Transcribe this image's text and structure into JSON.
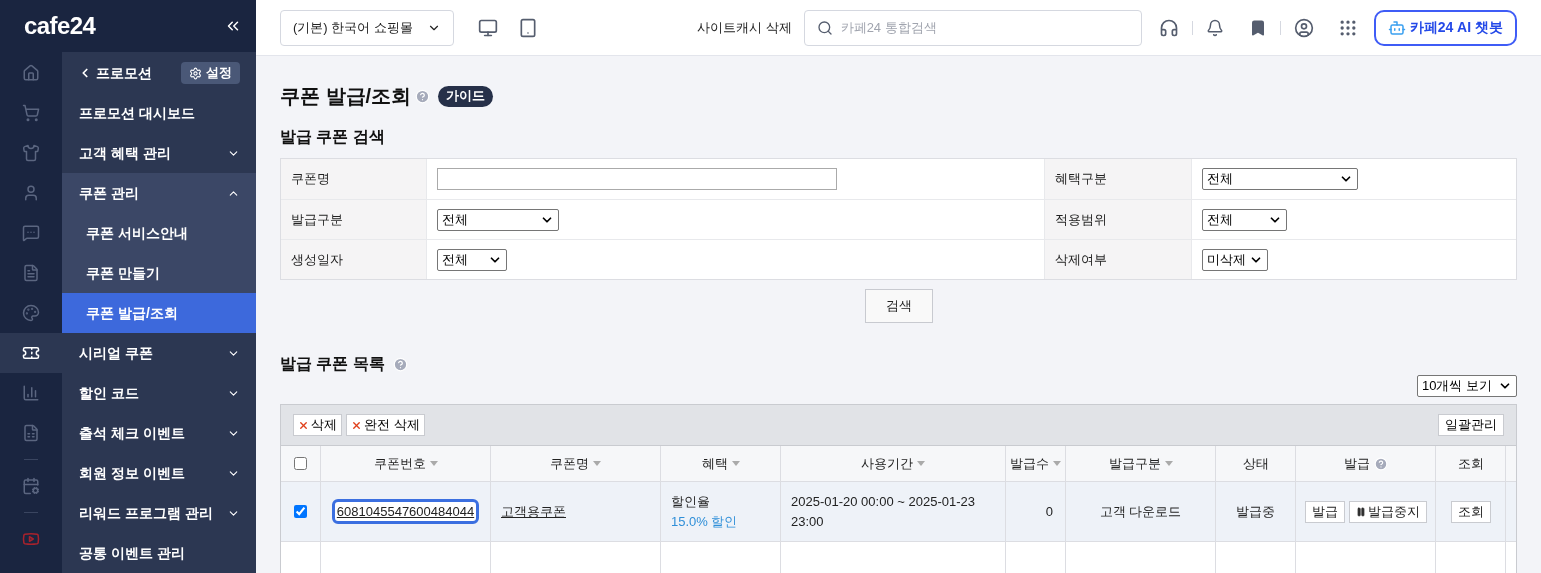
{
  "logo": "cafe24",
  "rail": [
    {
      "kind": "home",
      "selected": false
    },
    {
      "kind": "cart",
      "selected": false
    },
    {
      "kind": "shirt",
      "selected": false
    },
    {
      "kind": "user",
      "selected": false
    },
    {
      "kind": "chat",
      "selected": false
    },
    {
      "kind": "document",
      "selected": false
    },
    {
      "kind": "palette",
      "selected": false
    },
    {
      "kind": "coupon",
      "selected": true
    },
    {
      "kind": "chart",
      "selected": false
    },
    {
      "kind": "sheet",
      "selected": false
    },
    {
      "kind": "divider"
    },
    {
      "kind": "calendar",
      "selected": false
    },
    {
      "kind": "divider"
    },
    {
      "kind": "video",
      "selected": false
    }
  ],
  "submenu": {
    "back": "프로모션",
    "settings": "설정",
    "items": [
      {
        "label": "프로모션 대시보드",
        "kind": "link",
        "expanded": false
      },
      {
        "label": "고객 혜택 관리",
        "kind": "group",
        "expanded": false
      },
      {
        "label": "쿠폰 관리",
        "kind": "group",
        "expanded": true,
        "children": [
          {
            "label": "쿠폰 서비스안내",
            "selected": false
          },
          {
            "label": "쿠폰 만들기",
            "selected": false
          },
          {
            "label": "쿠폰 발급/조회",
            "selected": true
          }
        ]
      },
      {
        "label": "시리얼 쿠폰",
        "kind": "group",
        "expanded": false
      },
      {
        "label": "할인 코드",
        "kind": "group",
        "expanded": false
      },
      {
        "label": "출석 체크 이벤트",
        "kind": "group",
        "expanded": false
      },
      {
        "label": "회원 정보 이벤트",
        "kind": "group",
        "expanded": false
      },
      {
        "label": "리워드 프로그램 관리",
        "kind": "group",
        "expanded": false
      },
      {
        "label": "공통 이벤트 관리",
        "kind": "link",
        "expanded": false
      }
    ]
  },
  "topbar": {
    "store": "(기본) 한국어 쇼핑몰",
    "cache": "사이트캐시 삭제",
    "search_placeholder": "카페24 통합검색",
    "chatbot": "카페24 AI 챗봇"
  },
  "page": {
    "title": "쿠폰 발급/조회",
    "guide": "가이드",
    "search_title": "발급 쿠폰 검색",
    "search_rows": [
      [
        {
          "label": "쿠폰명",
          "kind": "text"
        },
        {
          "label": "혜택구분",
          "kind": "select",
          "value": "전체"
        }
      ],
      [
        {
          "label": "발급구분",
          "kind": "select",
          "value": "전체"
        },
        {
          "label": "적용범위",
          "kind": "select",
          "value": "전체"
        }
      ],
      [
        {
          "label": "생성일자",
          "kind": "select",
          "value": "전체"
        },
        {
          "label": "삭제여부",
          "kind": "select",
          "value": "미삭제"
        }
      ]
    ],
    "search_button": "검색",
    "list_title": "발급 쿠폰 목록",
    "page_size": "10개씩 보기",
    "delete": "삭제",
    "delete_all": "완전 삭제",
    "bulk": "일괄관리"
  },
  "table": {
    "all_checked": false,
    "columns": [
      {
        "label": "쿠폰번호",
        "sortable": true,
        "help": false
      },
      {
        "label": "쿠폰명",
        "sortable": true,
        "help": false
      },
      {
        "label": "혜택",
        "sortable": true,
        "help": false
      },
      {
        "label": "사용기간",
        "sortable": true,
        "help": false
      },
      {
        "label": "발급수",
        "sortable": true,
        "help": false
      },
      {
        "label": "발급구분",
        "sortable": true,
        "help": false
      },
      {
        "label": "상태",
        "sortable": false,
        "help": false
      },
      {
        "label": "발급",
        "sortable": false,
        "help": true
      },
      {
        "label": "조회",
        "sortable": false,
        "help": false
      }
    ],
    "rows": [
      {
        "checked": true,
        "focused": true,
        "coupon_no": "6081045547600484044",
        "coupon_name": "고객용쿠폰",
        "benefit_type": "할인율",
        "benefit_value": "15.0% 할인",
        "period": "2025-01-20 00:00 ~ 2025-01-23 23:00",
        "count": "0",
        "issue_type": "고객 다운로드",
        "status": "발급중",
        "issue": "발급",
        "stop": "발급중지",
        "view": "조회"
      }
    ]
  }
}
